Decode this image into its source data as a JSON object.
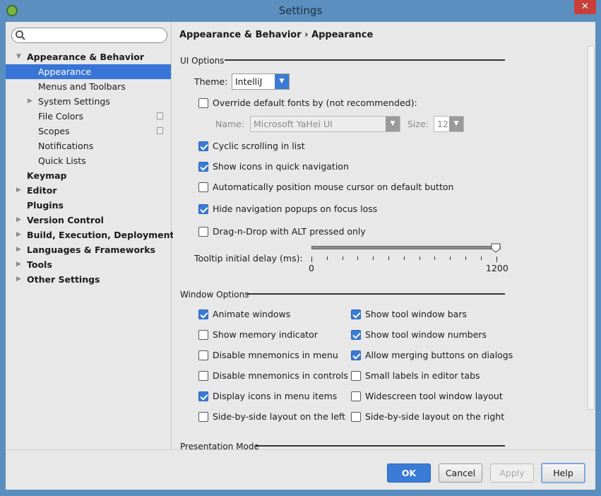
{
  "window": {
    "title": "Settings",
    "close": "✕"
  },
  "search": {
    "placeholder": ""
  },
  "tree": [
    {
      "label": "Appearance & Behavior",
      "bold": true,
      "arrow": "down",
      "indent": 0
    },
    {
      "label": "Appearance",
      "selected": true,
      "indent": 1
    },
    {
      "label": "Menus and Toolbars",
      "indent": 1
    },
    {
      "label": "System Settings",
      "arrow": "right",
      "indent": 1
    },
    {
      "label": "File Colors",
      "indent": 1,
      "copy": true
    },
    {
      "label": "Scopes",
      "indent": 1,
      "copy": true
    },
    {
      "label": "Notifications",
      "indent": 1
    },
    {
      "label": "Quick Lists",
      "indent": 1
    },
    {
      "label": "Keymap",
      "bold": true,
      "indent": 0
    },
    {
      "label": "Editor",
      "bold": true,
      "arrow": "right",
      "indent": 0
    },
    {
      "label": "Plugins",
      "bold": true,
      "indent": 0
    },
    {
      "label": "Version Control",
      "bold": true,
      "arrow": "right",
      "indent": 0
    },
    {
      "label": "Build, Execution, Deployment",
      "bold": true,
      "arrow": "right",
      "indent": 0
    },
    {
      "label": "Languages & Frameworks",
      "bold": true,
      "arrow": "right",
      "indent": 0
    },
    {
      "label": "Tools",
      "bold": true,
      "arrow": "right",
      "indent": 0
    },
    {
      "label": "Other Settings",
      "bold": true,
      "arrow": "right",
      "indent": 0
    }
  ],
  "breadcrumb": {
    "parent": "Appearance & Behavior",
    "sep": "›",
    "current": "Appearance"
  },
  "ui_options": {
    "title": "UI Options",
    "theme_label": "Theme:",
    "theme_value": "IntelliJ",
    "override": {
      "label": "Override default fonts by (not recommended):",
      "checked": false
    },
    "name_label": "Name:",
    "font_name": "Microsoft YaHei UI",
    "size_label": "Size:",
    "font_size": "12",
    "checks": [
      {
        "label": "Cyclic scrolling in list",
        "checked": true
      },
      {
        "label": "Show icons in quick navigation",
        "checked": true
      },
      {
        "label": "Automatically position mouse cursor on default button",
        "checked": false
      },
      {
        "label": "Hide navigation popups on focus loss",
        "checked": true
      },
      {
        "label": "Drag-n-Drop with ALT pressed only",
        "checked": false
      }
    ],
    "tooltip_label": "Tooltip initial delay (ms):",
    "slider_min": "0",
    "slider_max": "1200",
    "slider_value": 1200
  },
  "window_options": {
    "title": "Window Options",
    "left": [
      {
        "label": "Animate windows",
        "checked": true
      },
      {
        "label": "Show memory indicator",
        "checked": false
      },
      {
        "label": "Disable mnemonics in menu",
        "checked": false
      },
      {
        "label": "Disable mnemonics in controls",
        "checked": false
      },
      {
        "label": "Display icons in menu items",
        "checked": true
      },
      {
        "label": "Side-by-side layout on the left",
        "checked": false
      }
    ],
    "right": [
      {
        "label": "Show tool window bars",
        "checked": true
      },
      {
        "label": "Show tool window numbers",
        "checked": true
      },
      {
        "label": "Allow merging buttons on dialogs",
        "checked": true
      },
      {
        "label": "Small labels in editor tabs",
        "checked": false
      },
      {
        "label": "Widescreen tool window layout",
        "checked": false
      },
      {
        "label": "Side-by-side layout on the right",
        "checked": false
      }
    ]
  },
  "presentation": {
    "title": "Presentation Mode"
  },
  "buttons": {
    "ok": "OK",
    "cancel": "Cancel",
    "apply": "Apply",
    "help": "Help"
  }
}
